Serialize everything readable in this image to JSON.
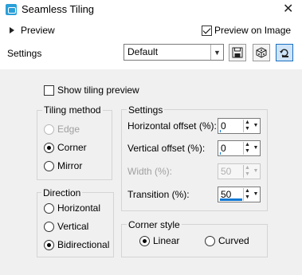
{
  "window": {
    "title": "Seamless Tiling",
    "close_glyph": "✕"
  },
  "header": {
    "preview_label": "Preview",
    "preview_on_image_label": "Preview on Image",
    "preview_on_image_checked": true,
    "settings_label": "Settings",
    "preset_value": "Default",
    "toolbar_icons": [
      "save-icon",
      "randomize-icon",
      "reset-icon"
    ]
  },
  "show_tiling_preview": {
    "label": "Show tiling preview",
    "checked": false
  },
  "tiling_method": {
    "title": "Tiling method",
    "options": [
      {
        "label": "Edge",
        "selected": false,
        "disabled": true
      },
      {
        "label": "Corner",
        "selected": true,
        "disabled": false
      },
      {
        "label": "Mirror",
        "selected": false,
        "disabled": false
      }
    ]
  },
  "direction": {
    "title": "Direction",
    "options": [
      {
        "label": "Horizontal",
        "selected": false
      },
      {
        "label": "Vertical",
        "selected": false
      },
      {
        "label": "Bidirectional",
        "selected": true
      }
    ]
  },
  "settings": {
    "title": "Settings",
    "horizontal_offset": {
      "label": "Horizontal offset (%):",
      "value": "0"
    },
    "vertical_offset": {
      "label": "Vertical offset (%):",
      "value": "0"
    },
    "width": {
      "label": "Width (%):",
      "value": "50",
      "disabled": true
    },
    "transition": {
      "label": "Transition (%):",
      "value": "50"
    }
  },
  "corner_style": {
    "title": "Corner style",
    "options": [
      {
        "label": "Linear",
        "selected": true
      },
      {
        "label": "Curved",
        "selected": false
      }
    ]
  },
  "colors": {
    "accent": "#0e78d4",
    "panel_bg": "#f0f0f0",
    "app_icon": "#2a9fd8"
  }
}
